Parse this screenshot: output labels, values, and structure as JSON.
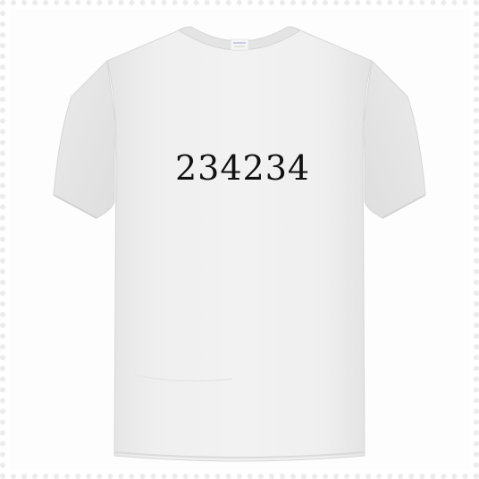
{
  "shirt": {
    "print_text": "234234",
    "tag_text": "",
    "colors": {
      "fabric": "#efefef",
      "fabric_shadow": "#dcdcdc",
      "fabric_highlight": "#f7f7f7",
      "collar": "#e6e6e6",
      "print": "#111111",
      "frame_border": "#ececec"
    }
  }
}
